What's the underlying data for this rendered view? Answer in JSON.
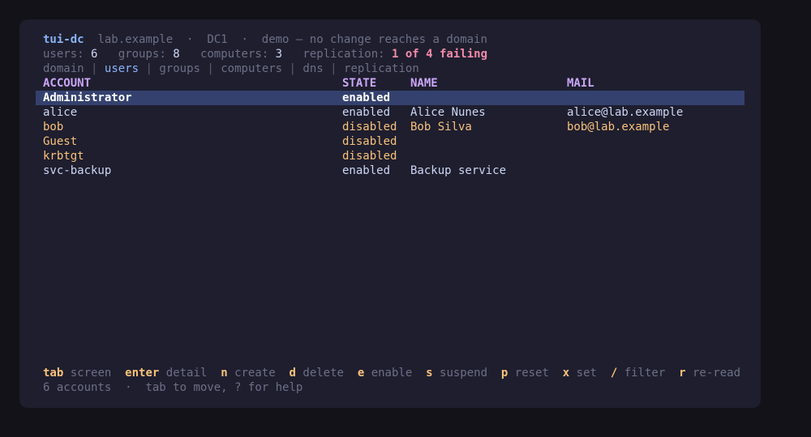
{
  "header": {
    "app": "tui-dc",
    "domain": "lab.example",
    "dot": "·",
    "dc": "DC1",
    "mode": "demo — no change reaches a domain"
  },
  "stats": {
    "users_label": "users:",
    "users": "6",
    "groups_label": "groups:",
    "groups": "8",
    "computers_label": "computers:",
    "computers": "3",
    "replication_label": "replication:",
    "replication": "1 of 4 failing"
  },
  "tabs": [
    "domain",
    "users",
    "groups",
    "computers",
    "dns",
    "replication"
  ],
  "table": {
    "columns": [
      "ACCOUNT",
      "STATE",
      "NAME",
      "MAIL"
    ],
    "rows": [
      {
        "account": "Administrator",
        "state": "enabled",
        "name": "",
        "mail": ""
      },
      {
        "account": "alice",
        "state": "enabled",
        "name": "Alice Nunes",
        "mail": "alice@lab.example"
      },
      {
        "account": "bob",
        "state": "disabled",
        "name": "Bob Silva",
        "mail": "bob@lab.example"
      },
      {
        "account": "Guest",
        "state": "disabled",
        "name": "",
        "mail": ""
      },
      {
        "account": "krbtgt",
        "state": "disabled",
        "name": "",
        "mail": ""
      },
      {
        "account": "svc-backup",
        "state": "enabled",
        "name": "Backup service",
        "mail": ""
      }
    ]
  },
  "keybar": [
    {
      "key": "tab",
      "label": "screen"
    },
    {
      "key": "enter",
      "label": "detail"
    },
    {
      "key": "n",
      "label": "create"
    },
    {
      "key": "d",
      "label": "delete"
    },
    {
      "key": "e",
      "label": "enable"
    },
    {
      "key": "s",
      "label": "suspend"
    },
    {
      "key": "p",
      "label": "reset"
    },
    {
      "key": "x",
      "label": "set"
    },
    {
      "key": "/",
      "label": "filter"
    },
    {
      "key": "r",
      "label": "re-read"
    }
  ],
  "status": {
    "count": "6 accounts",
    "dot": "·",
    "hint": "tab to move, ? for help"
  }
}
